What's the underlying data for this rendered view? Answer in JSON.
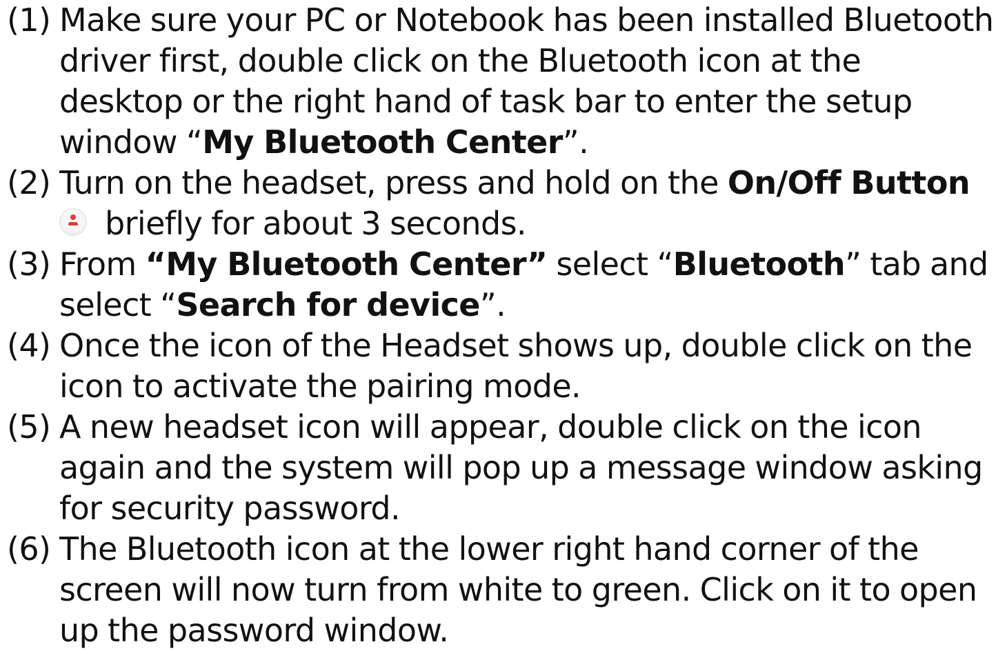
{
  "steps": [
    {
      "number": "(1)",
      "lines": [
        {
          "a": "Make sure your PC or Notebook has been installed Bluetooth"
        },
        {
          "a": "driver first, double click on the Bluetooth icon at the"
        },
        {
          "a": "desktop or the right hand of task bar to enter the setup"
        },
        {
          "a": "window “",
          "b": "My Bluetooth Center",
          "c": "”."
        }
      ]
    },
    {
      "number": "(2)",
      "lines": [
        {
          "a": "Turn on the headset, press and hold on the ",
          "b": "On/Off Button"
        },
        {
          "icon": "on-off-button-icon",
          "a": "briefly for about 3 seconds."
        }
      ]
    },
    {
      "number": "(3)",
      "lines": [
        {
          "a": "From ",
          "b": "“My Bluetooth Center”",
          "c": " select “",
          "d": "Bluetooth",
          "e": "” tab and"
        },
        {
          "a": "select “",
          "b": "Search for device",
          "c": "”."
        }
      ]
    },
    {
      "number": "(4)",
      "lines": [
        {
          "a": "Once the icon of the Headset shows up, double click on the"
        },
        {
          "a": "icon to activate the pairing mode."
        }
      ]
    },
    {
      "number": "(5)",
      "lines": [
        {
          "a": "A new headset icon will appear, double click on the icon"
        },
        {
          "a": "again and the system will pop up a message window asking"
        },
        {
          "a": "for security password."
        }
      ]
    },
    {
      "number": "(6)",
      "lines": [
        {
          "a": "The Bluetooth icon at the lower right hand corner of the"
        },
        {
          "a": "screen will now turn from white to green. Click on it to open"
        },
        {
          "a": "up the password window."
        }
      ]
    }
  ],
  "colors": {
    "text": "#111111",
    "icon_accent": "#e23a3a",
    "background": "#ffffff"
  }
}
